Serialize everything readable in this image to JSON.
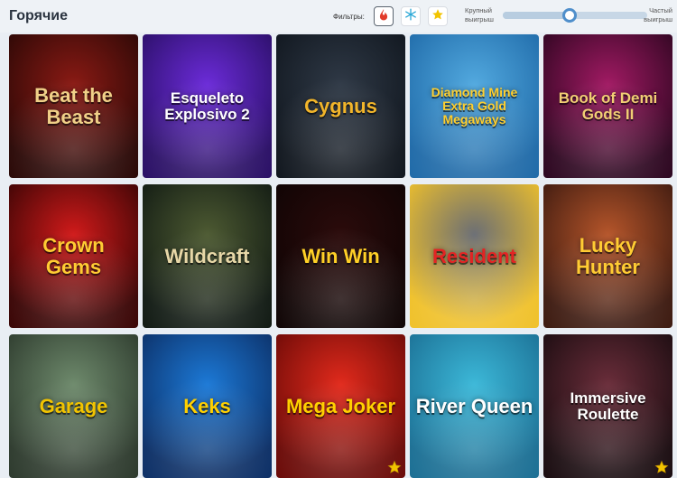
{
  "header": {
    "title": "Горячие",
    "filters_label": "Фильтры:",
    "filters": [
      {
        "id": "hot",
        "icon": "fire-icon",
        "color": "#e23b2a",
        "active": true
      },
      {
        "id": "new",
        "icon": "snowflake-icon",
        "color": "#2aa7d6",
        "active": false
      },
      {
        "id": "favorite",
        "icon": "star-icon",
        "color": "#f2c400",
        "active": false
      }
    ],
    "slider": {
      "left_label_line1": "Крупный",
      "left_label_line2": "выигрыш",
      "right_label_line1": "Частый",
      "right_label_line2": "выигрыш",
      "value": 0.46,
      "track_color": "#c7d7e6",
      "thumb_color": "#4f8fcb"
    }
  },
  "games": [
    {
      "title": "Beat the Beast",
      "bg1": "#8a1a14",
      "bg2": "#2a0806",
      "text_color": "#f0d088"
    },
    {
      "title": "Esqueleto Explosivo 2",
      "bg1": "#6b2bd8",
      "bg2": "#2a0f66",
      "text_color": "#ffffff"
    },
    {
      "title": "Cygnus",
      "bg1": "#2f3946",
      "bg2": "#10161e",
      "text_color": "#f2b52a"
    },
    {
      "title": "Diamond Mine Extra Gold Megaways",
      "bg1": "#52a9df",
      "bg2": "#1f6aa8",
      "text_color": "#ffcf2e"
    },
    {
      "title": "Book of Demi Gods II",
      "bg1": "#a11a63",
      "bg2": "#2d0620",
      "text_color": "#f1cf74"
    },
    {
      "title": "Crown Gems",
      "bg1": "#d01a1a",
      "bg2": "#3a0505",
      "text_color": "#ffcc33"
    },
    {
      "title": "Wildcraft",
      "bg1": "#4d5a32",
      "bg2": "#111a13",
      "text_color": "#e7d7a7"
    },
    {
      "title": "Win Win",
      "bg1": "#2b0b0b",
      "bg2": "#0f0404",
      "text_color": "#ffd027"
    },
    {
      "title": "Resident",
      "bg1": "#6b6e74",
      "bg2": "#f0c12a",
      "text_color": "#e32424"
    },
    {
      "title": "Lucky Hunter",
      "bg1": "#b5552a",
      "bg2": "#3d1a10",
      "text_color": "#ffcc33"
    },
    {
      "title": "Garage",
      "bg1": "#6e8a6c",
      "bg2": "#2d3a2d",
      "text_color": "#f2c400"
    },
    {
      "title": "Keks",
      "bg1": "#1c79d6",
      "bg2": "#0c2f66",
      "text_color": "#ffd000"
    },
    {
      "title": "Mega Joker",
      "bg1": "#e12a1c",
      "bg2": "#6b0a07",
      "text_color": "#ffd000"
    },
    {
      "title": "River Queen",
      "bg1": "#3cb8d8",
      "bg2": "#1b6f94",
      "text_color": "#ffffff"
    },
    {
      "title": "Immersive Roulette",
      "bg1": "#6a2d3a",
      "bg2": "#1a0c10",
      "text_color": "#ffffff"
    }
  ]
}
